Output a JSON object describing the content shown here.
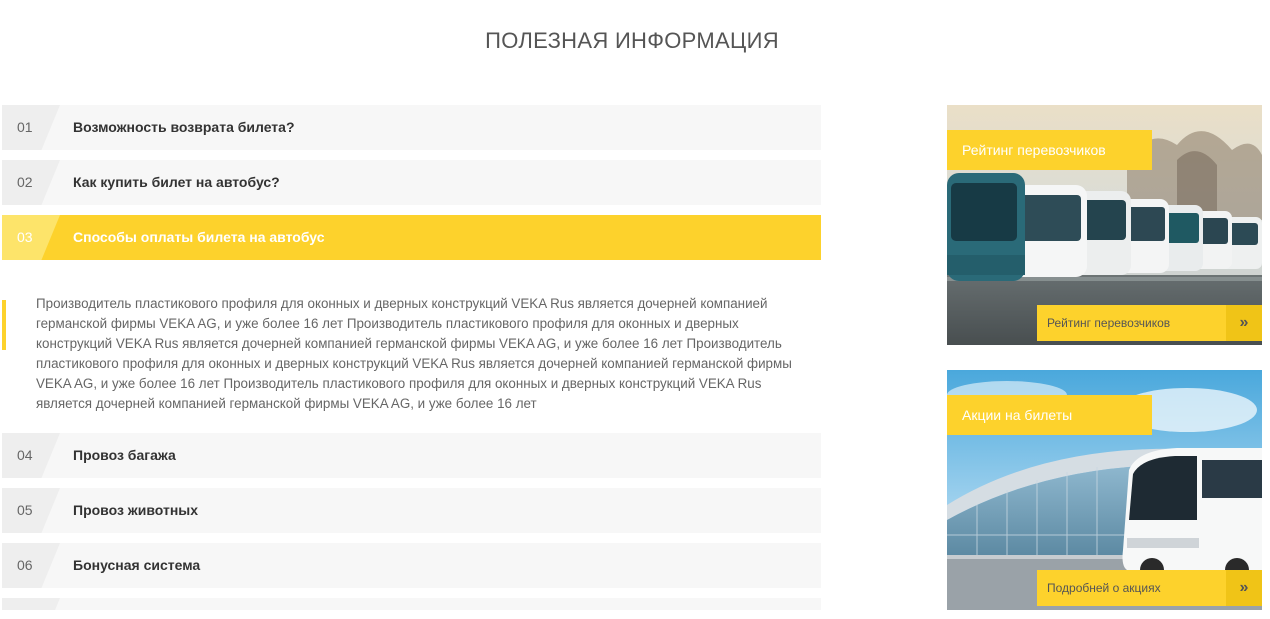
{
  "page": {
    "title": "ПОЛЕЗНАЯ ИНФОРМАЦИЯ"
  },
  "accordion": {
    "items": [
      {
        "num": "01",
        "title": "Возможность возврата билета?"
      },
      {
        "num": "02",
        "title": "Как купить билет на автобус?"
      },
      {
        "num": "03",
        "title": "Способы оплаты билета на автобус"
      },
      {
        "num": "04",
        "title": "Провоз багажа"
      },
      {
        "num": "05",
        "title": "Провоз животных"
      },
      {
        "num": "06",
        "title": "Бонусная система"
      }
    ],
    "active_content": "Производитель пластикового профиля для оконных и дверных конструкций VEKA Rus является дочерней компанией германской фирмы VEKA AG, и уже более 16 лет Производитель пластикового профиля для оконных и дверных конструкций VEKA Rus является дочерней компанией германской фирмы VEKA AG, и уже более 16 лет Производитель пластикового профиля для оконных и дверных конструкций VEKA Rus является дочерней компанией германской фирмы VEKA AG, и уже более 16 лет Производитель пластикового профиля для оконных и дверных конструкций VEKA Rus является дочерней компанией германской фирмы VEKA AG, и уже более 16 лет"
  },
  "cards": [
    {
      "label": "Рейтинг перевозчиков",
      "button": "Рейтинг перевозчиков",
      "arrow": "»"
    },
    {
      "label": "Акции на билеты",
      "button": "Подробней о акциях",
      "arrow": "»"
    }
  ],
  "colors": {
    "accent": "#fdd22c",
    "item_bg": "#f7f7f7"
  }
}
